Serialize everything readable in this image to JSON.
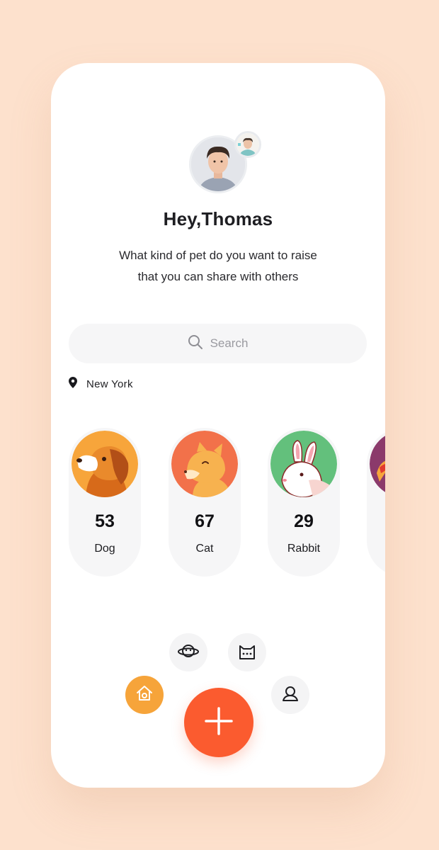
{
  "profile": {
    "greeting": "Hey,Thomas",
    "subtitle_line1": "What kind of pet do you want to raise",
    "subtitle_line2": "that you can share with others"
  },
  "search": {
    "placeholder": "Search",
    "icon": "search-icon"
  },
  "location": {
    "icon": "map-pin-icon",
    "label": "New York"
  },
  "pets": [
    {
      "name": "Dog",
      "count": "53",
      "color": "#f7a53b"
    },
    {
      "name": "Cat",
      "count": "67",
      "color": "#f2714a"
    },
    {
      "name": "Rabbit",
      "count": "29",
      "color": "#63c07c"
    },
    {
      "name": "",
      "count": "",
      "color": "#8b3a6b"
    }
  ],
  "nav": {
    "items": [
      {
        "icon": "home-icon",
        "active": true
      },
      {
        "icon": "planet-icon",
        "active": false
      },
      {
        "icon": "cat-chat-icon",
        "active": false
      },
      {
        "icon": "profile-icon",
        "active": false
      }
    ],
    "fab_icon": "plus-icon"
  },
  "colors": {
    "background": "#fde1cd",
    "accent_orange": "#f6a43a",
    "accent_red": "#fb5b2f",
    "card_bg": "#f6f6f7"
  }
}
